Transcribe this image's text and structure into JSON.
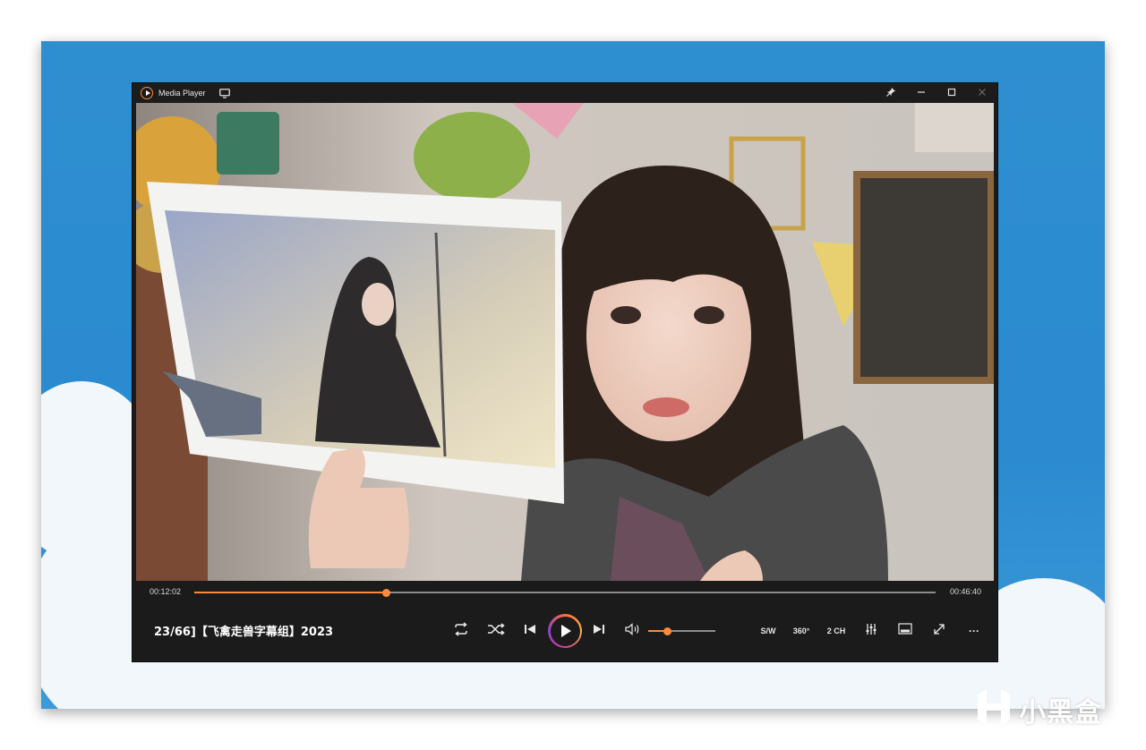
{
  "window": {
    "title": "Media Player",
    "controls": [
      "pin",
      "minimize",
      "maximize",
      "close"
    ]
  },
  "playback": {
    "current_time": "00:12:02",
    "duration": "00:46:40",
    "progress": 0.258,
    "volume": 0.28,
    "state": "paused"
  },
  "now_playing": {
    "title": "23/66]【飞禽走兽字幕组】2023"
  },
  "buttons": {
    "subtitle_label": "S/W",
    "vr_label": "360°",
    "audio_channel_label": "2 CH",
    "more_label": "···"
  },
  "icons": {
    "app": "media-player-logo-icon",
    "cast": "cast-screen-icon",
    "pin": "pin-icon",
    "repeat": "repeat-icon",
    "shuffle": "shuffle-icon",
    "previous": "skip-previous-icon",
    "play": "play-icon",
    "next": "skip-next-icon",
    "volume": "volume-icon",
    "equalizer": "equalizer-icon",
    "miniplayer": "miniplayer-icon",
    "fullscreen": "fullscreen-icon"
  },
  "colors": {
    "accent": "#ff8a3d",
    "window_bg": "#1b1b1b",
    "wallpaper": "#2e8fd0"
  },
  "watermark": {
    "text": "小黑盒"
  }
}
